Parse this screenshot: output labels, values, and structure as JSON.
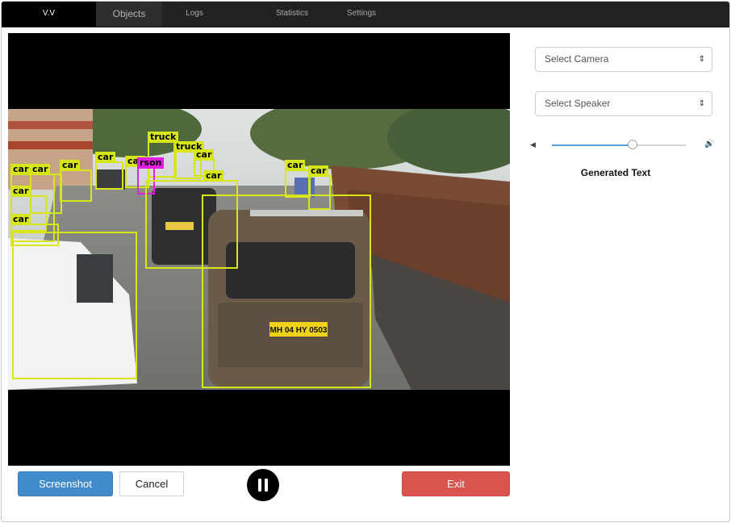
{
  "nav": {
    "brand": "V.V",
    "items": [
      "Objects",
      "Logs",
      "Statistics",
      "Settings"
    ]
  },
  "video": {
    "detections": [
      {
        "label": "car"
      },
      {
        "label": "car"
      },
      {
        "label": "car"
      },
      {
        "label": "car"
      },
      {
        "label": "car"
      },
      {
        "label": "car"
      },
      {
        "label": "car"
      },
      {
        "label": "car"
      },
      {
        "label": "truck"
      },
      {
        "label": "truck"
      },
      {
        "label": "car"
      },
      {
        "label": "rson"
      },
      {
        "label": "car"
      },
      {
        "label": "car"
      },
      {
        "label": "car"
      },
      {
        "label": "car"
      }
    ],
    "plate_text": "MH 04 HY 0503"
  },
  "controls": {
    "screenshot_label": "Screenshot",
    "cancel_label": "Cancel",
    "pause_icon": "pause-icon",
    "exit_label": "Exit"
  },
  "panel": {
    "camera_placeholder": "Select Camera",
    "speaker_placeholder": "Select Speaker",
    "volume_level": 0.6,
    "generated_text_label": "Generated Text"
  },
  "colors": {
    "nav_bg": "#222222",
    "primary": "#428bca",
    "danger": "#d9534f",
    "detection_box": "#d7e61a",
    "person_box": "#e11fe0"
  }
}
